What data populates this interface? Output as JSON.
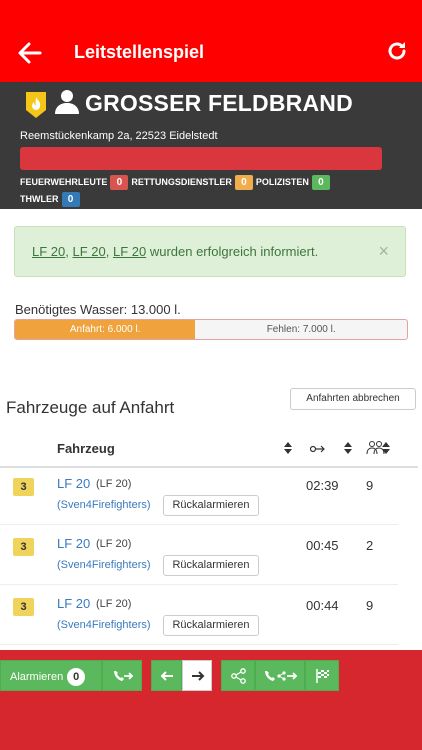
{
  "appbar": {
    "title": "Leitstellenspiel"
  },
  "mission": {
    "title": "GROSSER FELDBRAND",
    "address": "Reemstückenkamp 2a, 22523 Eidelstedt",
    "progress": 1.0,
    "counters": [
      {
        "label": "FEUERWEHRLEUTE",
        "value": "0",
        "color": "#d9534f"
      },
      {
        "label": "RETTUNGSDIENSTLER",
        "value": "0",
        "color": "#f0ad4e"
      },
      {
        "label": "POLIZISTEN",
        "value": "0",
        "color": "#5cb85c"
      },
      {
        "label": "THWLER",
        "value": "0",
        "color": "#337ab7"
      }
    ]
  },
  "alert": {
    "v1": "LF 20",
    "sep1": ", ",
    "v2": "LF 20",
    "sep2": ", ",
    "v3": "LF 20",
    "message": " wurden erfolgreich informiert.",
    "close": "×"
  },
  "water": {
    "label": "Benötigtes Wasser: 13.000 l.",
    "arrival_label": "Anfahrt: 6.000 l.",
    "missing_label": "Fehlen: 7.000 l.",
    "arrival_fraction": 0.46
  },
  "vehicles": {
    "section_title": "Fahrzeuge auf Anfahrt",
    "cancel_label": "Anfahrten abbrechen",
    "col_vehicle": "Fahrzeug",
    "rows": [
      {
        "status": "3",
        "name": "LF 20",
        "type": "(LF 20)",
        "owner": "(Sven4Firefighters)",
        "recall": "Rückalarmieren",
        "eta": "02:39",
        "crew": "9"
      },
      {
        "status": "3",
        "name": "LF 20",
        "type": "(LF 20)",
        "owner": "(Sven4Firefighters)",
        "recall": "Rückalarmieren",
        "eta": "00:45",
        "crew": "2"
      },
      {
        "status": "3",
        "name": "LF 20",
        "type": "(LF 20)",
        "owner": "(Sven4Firefighters)",
        "recall": "Rückalarmieren",
        "eta": "00:44",
        "crew": "9"
      }
    ]
  },
  "footer": {
    "alarm_label": "Alarmieren",
    "alarm_count": "0"
  },
  "colors": {
    "appbar": "#ff0000",
    "footer": "#d6262e",
    "success": "#5cb85c",
    "warning": "#f0a33c"
  }
}
